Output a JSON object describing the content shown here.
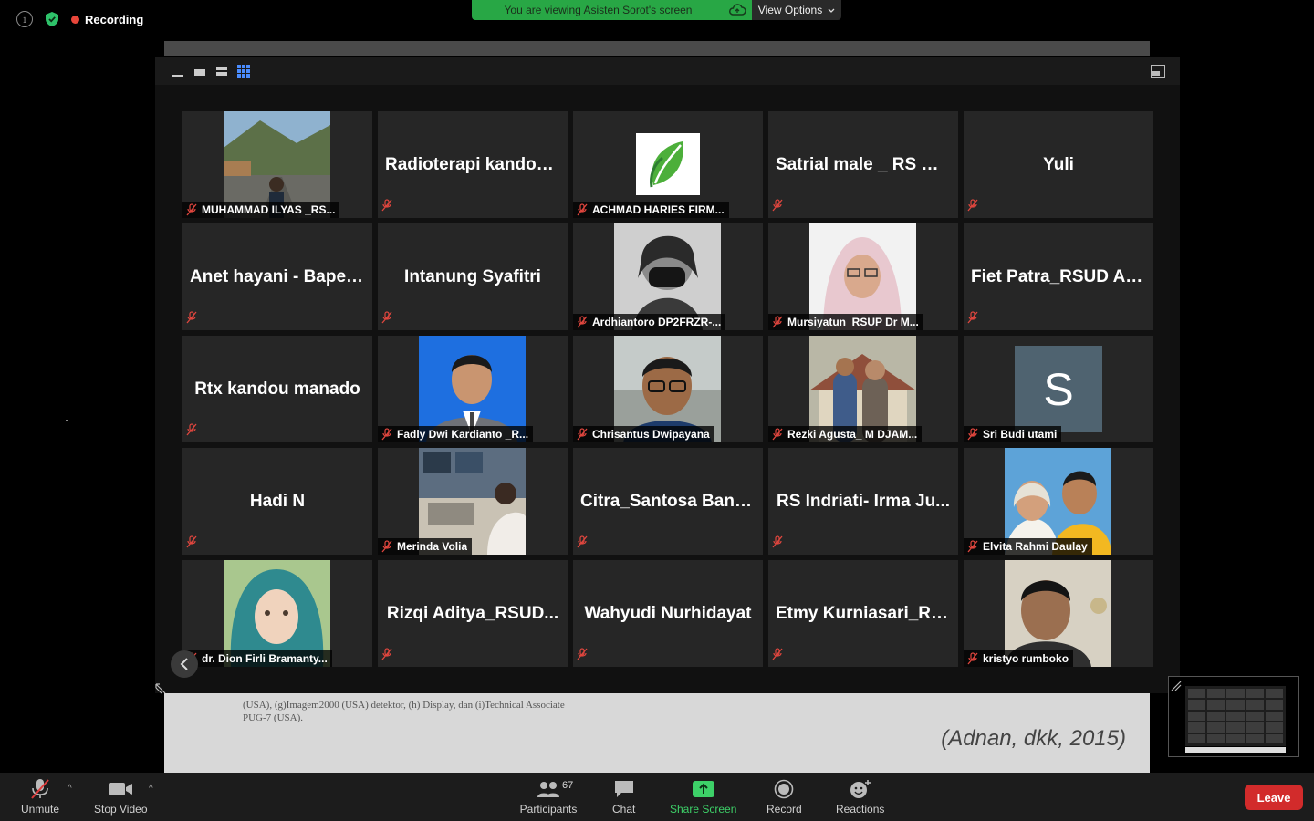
{
  "status": {
    "recording_label": "Recording",
    "colors": {
      "recording": "#e8463a",
      "shield": "#2ec26a"
    }
  },
  "banner": {
    "viewing_text": "You are viewing Asisten Sorot's screen",
    "view_options_label": "View Options",
    "color": "#28a745"
  },
  "slide": {
    "partial_text_line1": "(USA),   (g)Imagem2000 (USA) detektor, (h) Display, dan (i)Technical Associate",
    "partial_text_line2": "PUG-7 (USA).",
    "citation": "(Adnan, dkk, 2015)"
  },
  "gallery": {
    "view_icons": [
      "minimize-icon",
      "speaker-view-icon",
      "strip-view-icon",
      "gallery-view-icon"
    ],
    "tiles": [
      {
        "kind": "photo",
        "label": "MUHAMMAD ILYAS _RS...",
        "photo": "road-scene"
      },
      {
        "kind": "name",
        "name": "Radioterapi kandou..."
      },
      {
        "kind": "logo",
        "label": "ACHMAD HARIES FIRM..."
      },
      {
        "kind": "name",
        "name": "Satrial male _ RS Un..."
      },
      {
        "kind": "name",
        "name": "Yuli"
      },
      {
        "kind": "name",
        "name": "Anet hayani - Bapet..."
      },
      {
        "kind": "name",
        "name": "Intanung Syafitri"
      },
      {
        "kind": "photo",
        "label": "Ardhiantoro DP2FRZR-...",
        "photo": "masked-person"
      },
      {
        "kind": "photo",
        "label": "Mursiyatun_RSUP Dr M...",
        "photo": "hijab-person"
      },
      {
        "kind": "name",
        "name": "Fiet Patra_RSUD Ari..."
      },
      {
        "kind": "name",
        "name": "Rtx kandou manado"
      },
      {
        "kind": "photo",
        "label": "Fadly Dwi Kardianto _R...",
        "photo": "suit-portrait"
      },
      {
        "kind": "photo",
        "label": "Chrisantus Dwipayana",
        "photo": "selfie"
      },
      {
        "kind": "photo",
        "label": "Rezki Agusta_ M DJAM...",
        "photo": "couple"
      },
      {
        "kind": "avatar",
        "label": "Sri Budi utami",
        "initial": "S"
      },
      {
        "kind": "name",
        "name": "Hadi N"
      },
      {
        "kind": "photo",
        "label": "Merinda Volia",
        "photo": "control-room"
      },
      {
        "kind": "name",
        "name": "Citra_Santosa Band..."
      },
      {
        "kind": "name",
        "name": "RS Indriati- Irma Ju..."
      },
      {
        "kind": "photo",
        "label": "Elvita Rahmi Daulay",
        "photo": "couple-yellow"
      },
      {
        "kind": "photo",
        "label": "dr. Dion Firli Bramanty...",
        "photo": "child-hijab"
      },
      {
        "kind": "name",
        "name": "Rizqi Aditya_RSUD..."
      },
      {
        "kind": "name",
        "name": "Wahyudi Nurhidayat"
      },
      {
        "kind": "name",
        "name": "Etmy Kurniasari_Ra..."
      },
      {
        "kind": "photo",
        "label": "kristyo rumboko",
        "photo": "office-man"
      }
    ]
  },
  "controls": {
    "unmute": "Unmute",
    "stop_video": "Stop Video",
    "participants": "Participants",
    "participants_count": "67",
    "chat": "Chat",
    "share_screen": "Share Screen",
    "record": "Record",
    "reactions": "Reactions",
    "leave": "Leave",
    "leave_color": "#d22b2b",
    "share_color": "#3dd068"
  }
}
